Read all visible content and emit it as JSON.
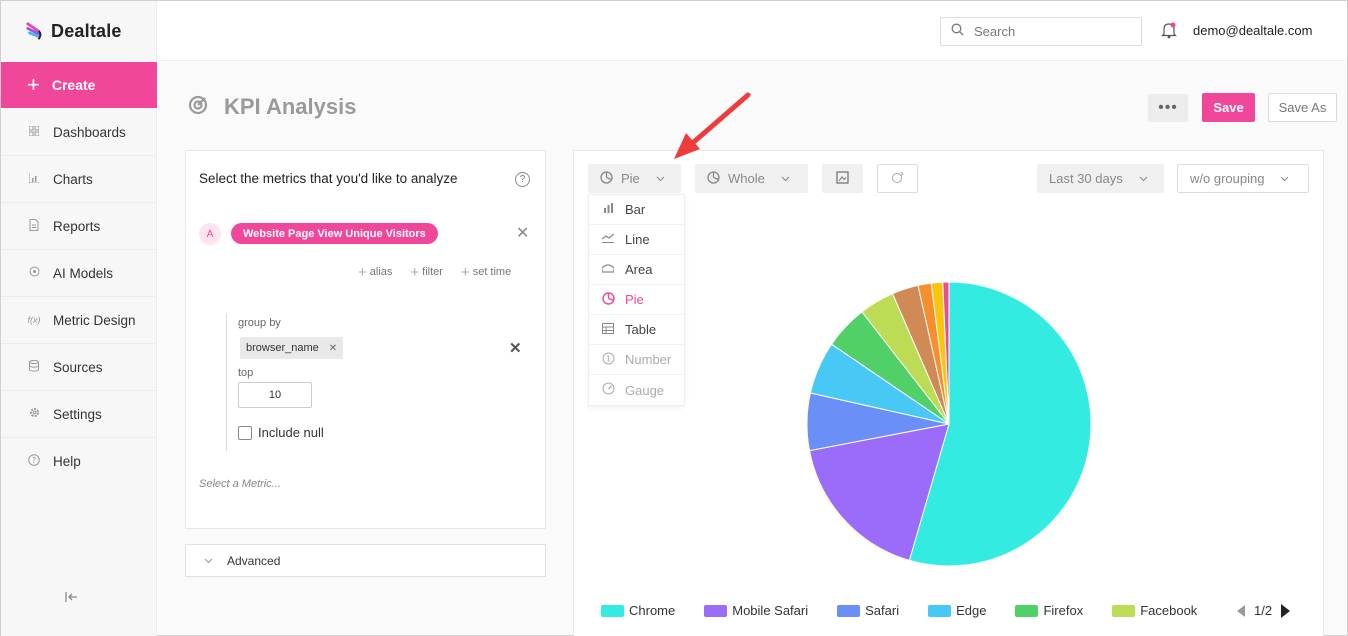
{
  "app": {
    "name": "Dealtale"
  },
  "sidebar": {
    "create_label": "Create",
    "items": [
      {
        "label": "Dashboards",
        "icon": "grid-icon"
      },
      {
        "label": "Charts",
        "icon": "bar-chart-icon"
      },
      {
        "label": "Reports",
        "icon": "document-icon"
      },
      {
        "label": "AI Models",
        "icon": "ai-icon"
      },
      {
        "label": "Metric Design",
        "icon": "function-icon"
      },
      {
        "label": "Sources",
        "icon": "database-icon"
      },
      {
        "label": "Settings",
        "icon": "gear-icon"
      },
      {
        "label": "Help",
        "icon": "help-icon"
      }
    ]
  },
  "topbar": {
    "search_placeholder": "Search",
    "user_email": "demo@dealtale.com"
  },
  "page": {
    "title": "KPI Analysis",
    "save_label": "Save",
    "save_as_label": "Save As"
  },
  "metrics_panel": {
    "heading": "Select the metrics that you'd like to analyze",
    "metric_letter": "A",
    "metric_name": "Website Page View Unique Visitors",
    "options": {
      "alias": "alias",
      "filter": "filter",
      "set_time": "set time"
    },
    "group_by_label": "group by",
    "group_by_value": "browser_name",
    "top_label": "top",
    "top_value": "10",
    "include_null_label": "Include null",
    "select_metric_placeholder": "Select a Metric...",
    "advanced_label": "Advanced"
  },
  "chart_toolbar": {
    "chart_type": "Pie",
    "scope": "Whole",
    "date_range": "Last 30 days",
    "grouping": "w/o grouping",
    "chart_type_options": [
      {
        "label": "Bar",
        "icon": "bar-chart-icon",
        "state": "normal"
      },
      {
        "label": "Line",
        "icon": "line-chart-icon",
        "state": "normal"
      },
      {
        "label": "Area",
        "icon": "area-chart-icon",
        "state": "normal"
      },
      {
        "label": "Pie",
        "icon": "pie-chart-icon",
        "state": "active"
      },
      {
        "label": "Table",
        "icon": "table-icon",
        "state": "normal"
      },
      {
        "label": "Number",
        "icon": "number-icon",
        "state": "disabled"
      },
      {
        "label": "Gauge",
        "icon": "gauge-icon",
        "state": "disabled"
      }
    ]
  },
  "chart_data": {
    "type": "pie",
    "series": [
      {
        "name": "Chrome",
        "value": 54.5,
        "color": "#34ebe2"
      },
      {
        "name": "Mobile Safari",
        "value": 17.5,
        "color": "#9b6bfa"
      },
      {
        "name": "Safari",
        "value": 6.5,
        "color": "#6a8ff7"
      },
      {
        "name": "Edge",
        "value": 6.0,
        "color": "#47c8f5"
      },
      {
        "name": "Firefox",
        "value": 5.0,
        "color": "#52d068"
      },
      {
        "name": "Facebook",
        "value": 4.0,
        "color": "#bcdc55"
      },
      {
        "name": "",
        "value": 3.0,
        "color": "#cf8a55"
      },
      {
        "name": "",
        "value": 1.5,
        "color": "#f88f2c"
      },
      {
        "name": "",
        "value": 1.3,
        "color": "#fbc50e"
      },
      {
        "name": "",
        "value": 0.7,
        "color": "#f04a94"
      }
    ],
    "legend_position": "bottom",
    "legend_page": "1/2"
  },
  "colors": {
    "accent": "#f1479a"
  }
}
